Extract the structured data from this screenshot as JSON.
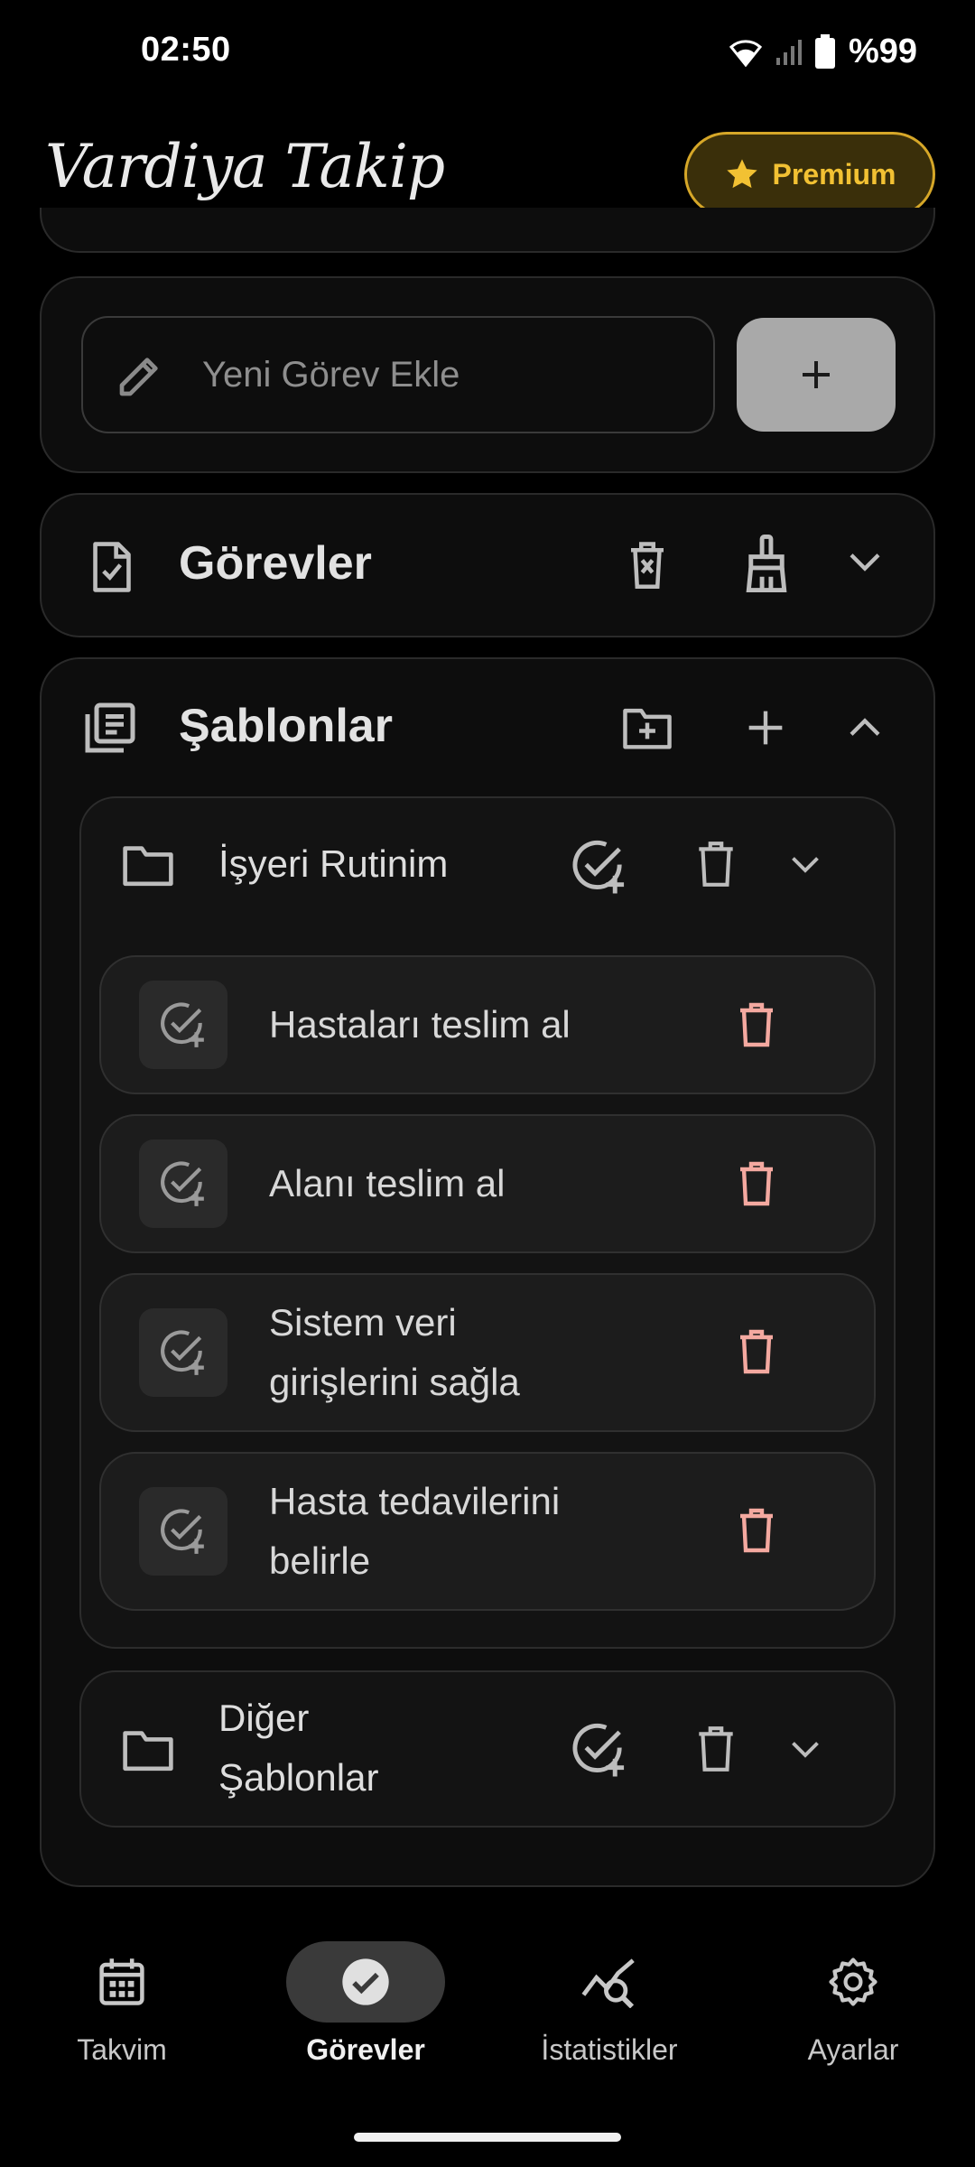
{
  "status_bar": {
    "time": "02:50",
    "battery": "%99"
  },
  "header": {
    "app_title": "Vardiya Takip",
    "premium_label": "Premium"
  },
  "new_task": {
    "placeholder": "Yeni Görev Ekle",
    "add_label": "+"
  },
  "tasks_section": {
    "title": "Görevler"
  },
  "templates_section": {
    "title": "Şablonlar",
    "folders": [
      {
        "name": "İşyeri Rutinim",
        "expanded": true,
        "items": [
          {
            "text": "Hastaları teslim al"
          },
          {
            "text": "Alanı teslim al"
          },
          {
            "text": "Sistem veri girişlerini sağla"
          },
          {
            "text": "Hasta tedavilerini belirle"
          }
        ]
      },
      {
        "name": "Diğer Şablonlar",
        "expanded": false,
        "items": []
      }
    ]
  },
  "bottom_nav": [
    {
      "label": "Takvim",
      "icon": "calendar-icon",
      "active": false
    },
    {
      "label": "Görevler",
      "icon": "check-circle-icon",
      "active": true
    },
    {
      "label": "İstatistikler",
      "icon": "analytics-icon",
      "active": false
    },
    {
      "label": "Ayarlar",
      "icon": "gear-icon",
      "active": false
    }
  ],
  "colors": {
    "premium_gold": "#f2c133",
    "delete_pink": "#f4a9a0",
    "accent_grey": "#a9a9a9"
  }
}
